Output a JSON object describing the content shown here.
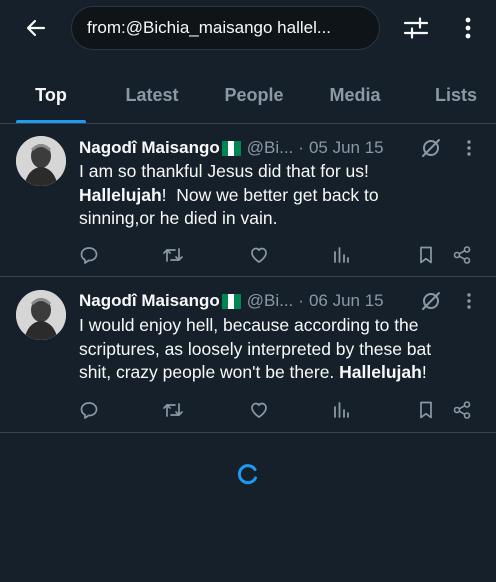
{
  "search": {
    "query": "from:@Bichia_maisango hallel..."
  },
  "tabs": [
    {
      "label": "Top",
      "active": true
    },
    {
      "label": "Latest",
      "active": false
    },
    {
      "label": "People",
      "active": false
    },
    {
      "label": "Media",
      "active": false
    },
    {
      "label": "Lists",
      "active": false
    }
  ],
  "tweets": [
    {
      "author": "Nagodî Maisango",
      "handle": "@Bi...",
      "separator": "·",
      "date": "05 Jun 15",
      "text": {
        "line1": "I am so thankful Jesus did that for us!",
        "highlight": "Hallelujah",
        "after_highlight": "!  Now we better get back to",
        "line3": "sinning,or he died in vain."
      }
    },
    {
      "author": "Nagodî Maisango",
      "handle": "@Bi...",
      "separator": "·",
      "date": "06 Jun 15",
      "text": {
        "line1": "I would enjoy hell, because according to the",
        "line2": "scriptures, as loosely interpreted by these bat",
        "before_highlight": "shit, crazy people won't be there. ",
        "highlight": "Hallelujah",
        "after_highlight": "!"
      }
    }
  ],
  "icons": {
    "back": "arrow-left-icon",
    "filter": "sliders-icon",
    "more": "vertical-ellipsis-icon",
    "grok": "grok-icon",
    "reply": "reply-icon",
    "retweet": "retweet-icon",
    "like": "heart-icon",
    "views": "bar-chart-icon",
    "bookmark": "bookmark-icon",
    "share": "share-icon",
    "loading": "loading-spinner-icon"
  },
  "colors": {
    "background": "#15202b",
    "accent": "#1d9bf0",
    "text_primary": "#f7f9f9",
    "text_secondary": "#8b98a5",
    "divider": "#38444d",
    "flag_green": "#008751",
    "flag_white": "#ffffff"
  }
}
